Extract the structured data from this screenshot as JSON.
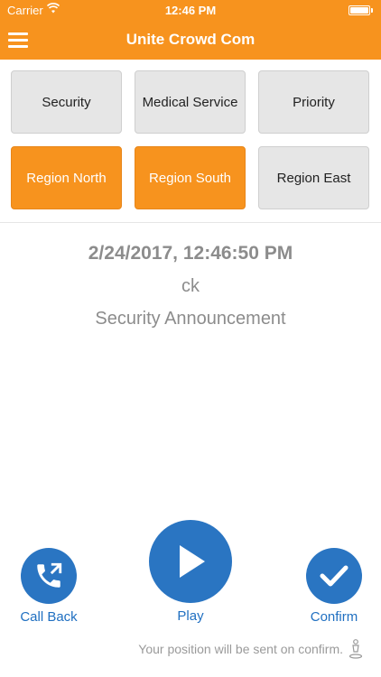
{
  "status_bar": {
    "carrier": "Carrier",
    "time": "12:46 PM"
  },
  "nav": {
    "title": "Unite Crowd Com"
  },
  "categories": [
    {
      "label": "Security",
      "active": false
    },
    {
      "label": "Medical Service",
      "active": false
    },
    {
      "label": "Priority",
      "active": false
    },
    {
      "label": "Region North",
      "active": true
    },
    {
      "label": "Region South",
      "active": true
    },
    {
      "label": "Region East",
      "active": false
    }
  ],
  "message": {
    "timestamp": "2/24/2017, 12:46:50 PM",
    "sender": "ck",
    "type": "Security Announcement"
  },
  "actions": {
    "call_back": "Call Back",
    "play": "Play",
    "confirm": "Confirm"
  },
  "footer": {
    "note": "Your position will be sent on confirm."
  },
  "colors": {
    "accent": "#f7931e",
    "action_blue": "#2a75c2",
    "button_gray": "#e6e6e6"
  }
}
